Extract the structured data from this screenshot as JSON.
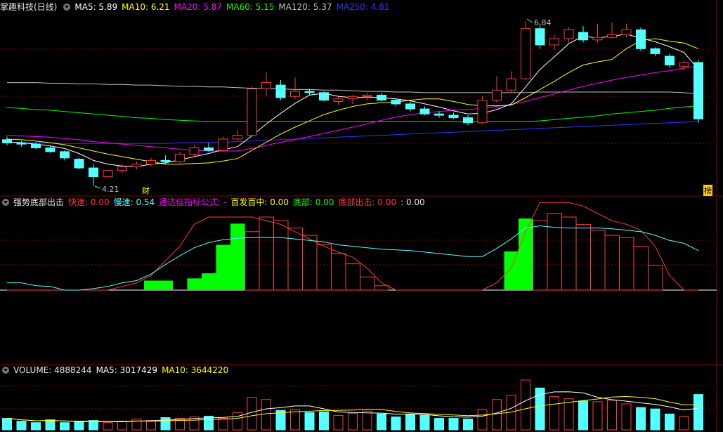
{
  "colors": {
    "up": "#ff3b3b",
    "down": "#54ffff",
    "ma5": "#ffffff",
    "ma10": "#ffff00",
    "ma20": "#ff00ff",
    "ma60": "#00ff00",
    "ma120": "#c0c0c0",
    "ma250": "#3333ff",
    "grid": "#800000",
    "green_bar": "#00ff00"
  },
  "price_panel": {
    "stock": "掌趣科技(日线)",
    "ma5": "MA5: 5.89",
    "ma10": "MA10: 6.21",
    "ma20": "MA20: 5.87",
    "ma60": "MA60: 5.15",
    "ma120": "MA120: 5.37",
    "ma250": "MA250: 4.81",
    "high_label": "6.84",
    "low_label": "4.21",
    "badge_cai": "财",
    "badge_bang": "榜"
  },
  "indicator_panel": {
    "title": "强势底部出击",
    "fast": "快速: 0.00",
    "slow": "慢速: 0.54",
    "formula": "通达信指标公式: -",
    "hit": "百发百中: 0.00",
    "bottom": "底部: 0.00",
    "bottom_out": "底部出击: 0.00",
    "extra": ": 0.00"
  },
  "volume_panel": {
    "volume": "VOLUME: 4888244",
    "ma5": "MA5: 3017429",
    "ma10": "MA10: 3644220"
  },
  "chart_data": {
    "type": "candlestick",
    "ohlc": [
      [
        4.95,
        5.0,
        4.86,
        4.9
      ],
      [
        4.9,
        4.93,
        4.84,
        4.88
      ],
      [
        4.88,
        4.91,
        4.8,
        4.82
      ],
      [
        4.82,
        4.86,
        4.74,
        4.76
      ],
      [
        4.76,
        4.78,
        4.62,
        4.66
      ],
      [
        4.64,
        4.66,
        4.48,
        4.5
      ],
      [
        4.5,
        4.56,
        4.21,
        4.36
      ],
      [
        4.36,
        4.48,
        4.34,
        4.46
      ],
      [
        4.46,
        4.56,
        4.42,
        4.52
      ],
      [
        4.52,
        4.6,
        4.48,
        4.56
      ],
      [
        4.56,
        4.66,
        4.52,
        4.62
      ],
      [
        4.62,
        4.7,
        4.56,
        4.6
      ],
      [
        4.6,
        4.76,
        4.58,
        4.72
      ],
      [
        4.72,
        4.86,
        4.68,
        4.82
      ],
      [
        4.82,
        4.9,
        4.76,
        4.78
      ],
      [
        4.78,
        5.0,
        4.76,
        4.96
      ],
      [
        4.96,
        5.1,
        4.94,
        5.02
      ],
      [
        5.02,
        5.8,
        5.0,
        5.76
      ],
      [
        5.76,
        6.02,
        5.64,
        5.86
      ],
      [
        5.82,
        5.9,
        5.58,
        5.62
      ],
      [
        5.64,
        5.94,
        5.6,
        5.72
      ],
      [
        5.72,
        5.76,
        5.66,
        5.7
      ],
      [
        5.7,
        5.72,
        5.56,
        5.58
      ],
      [
        5.56,
        5.64,
        5.5,
        5.6
      ],
      [
        5.6,
        5.66,
        5.52,
        5.64
      ],
      [
        5.64,
        5.7,
        5.58,
        5.66
      ],
      [
        5.66,
        5.7,
        5.56,
        5.58
      ],
      [
        5.58,
        5.62,
        5.48,
        5.52
      ],
      [
        5.52,
        5.56,
        5.4,
        5.44
      ],
      [
        5.44,
        5.48,
        5.34,
        5.36
      ],
      [
        5.36,
        5.4,
        5.3,
        5.34
      ],
      [
        5.34,
        5.38,
        5.28,
        5.3
      ],
      [
        5.3,
        5.34,
        5.18,
        5.22
      ],
      [
        5.22,
        5.64,
        5.2,
        5.58
      ],
      [
        5.58,
        5.96,
        5.54,
        5.74
      ],
      [
        5.74,
        6.04,
        5.7,
        5.92
      ],
      [
        5.92,
        6.84,
        5.9,
        6.72
      ],
      [
        6.72,
        6.8,
        6.4,
        6.46
      ],
      [
        6.46,
        6.62,
        6.38,
        6.56
      ],
      [
        6.56,
        6.74,
        6.48,
        6.7
      ],
      [
        6.66,
        6.76,
        6.5,
        6.54
      ],
      [
        6.54,
        6.8,
        6.5,
        6.58
      ],
      [
        6.58,
        6.82,
        6.56,
        6.62
      ],
      [
        6.62,
        6.8,
        6.58,
        6.7
      ],
      [
        6.7,
        6.74,
        6.36,
        6.4
      ],
      [
        6.4,
        6.42,
        6.28,
        6.32
      ],
      [
        6.28,
        6.32,
        6.1,
        6.14
      ],
      [
        6.12,
        6.2,
        6.06,
        6.18
      ],
      [
        6.18,
        6.22,
        5.22,
        5.28
      ]
    ],
    "ma5": [
      4.92,
      4.9,
      4.88,
      4.85,
      4.81,
      4.73,
      4.62,
      4.56,
      4.53,
      4.52,
      4.56,
      4.58,
      4.63,
      4.68,
      4.73,
      4.79,
      4.84,
      5.01,
      5.2,
      5.37,
      5.53,
      5.66,
      5.69,
      5.64,
      5.62,
      5.63,
      5.62,
      5.6,
      5.57,
      5.52,
      5.47,
      5.41,
      5.36,
      5.37,
      5.43,
      5.52,
      5.79,
      6.07,
      6.27,
      6.48,
      6.6,
      6.57,
      6.6,
      6.63,
      6.57,
      6.51,
      6.43,
      6.34,
      6.07
    ],
    "ma10": [
      4.96,
      4.95,
      4.93,
      4.9,
      4.87,
      4.82,
      4.77,
      4.72,
      4.68,
      4.64,
      4.6,
      4.56,
      4.56,
      4.57,
      4.58,
      4.61,
      4.65,
      4.78,
      4.91,
      5.04,
      5.15,
      5.25,
      5.35,
      5.42,
      5.48,
      5.52,
      5.54,
      5.55,
      5.58,
      5.6,
      5.6,
      5.56,
      5.51,
      5.49,
      5.49,
      5.5,
      5.62,
      5.75,
      5.88,
      6.02,
      6.14,
      6.19,
      6.23,
      6.4,
      6.53,
      6.56,
      6.52,
      6.49,
      6.4
    ],
    "ma20": [
      5.02,
      5.01,
      5.0,
      4.99,
      4.97,
      4.95,
      4.92,
      4.9,
      4.88,
      4.86,
      4.84,
      4.82,
      4.8,
      4.78,
      4.77,
      4.77,
      4.77,
      4.81,
      4.86,
      4.91,
      4.95,
      5.0,
      5.05,
      5.1,
      5.15,
      5.2,
      5.26,
      5.31,
      5.35,
      5.38,
      5.4,
      5.42,
      5.43,
      5.45,
      5.48,
      5.51,
      5.56,
      5.62,
      5.68,
      5.74,
      5.8,
      5.85,
      5.9,
      5.94,
      5.98,
      6.02,
      6.05,
      6.09,
      6.12
    ],
    "ma60": [
      5.46,
      5.45,
      5.43,
      5.42,
      5.4,
      5.38,
      5.36,
      5.34,
      5.32,
      5.3,
      5.29,
      5.27,
      5.26,
      5.25,
      5.24,
      5.24,
      5.24,
      5.24,
      5.24,
      5.24,
      5.24,
      5.24,
      5.24,
      5.24,
      5.24,
      5.24,
      5.24,
      5.24,
      5.24,
      5.24,
      5.24,
      5.24,
      5.24,
      5.24,
      5.24,
      5.24,
      5.24,
      5.25,
      5.27,
      5.29,
      5.31,
      5.33,
      5.36,
      5.38,
      5.4,
      5.42,
      5.45,
      5.47,
      5.49
    ],
    "ma120": [
      5.86,
      5.86,
      5.86,
      5.85,
      5.85,
      5.84,
      5.84,
      5.83,
      5.83,
      5.82,
      5.82,
      5.81,
      5.8,
      5.8,
      5.79,
      5.79,
      5.78,
      5.77,
      5.77,
      5.76,
      5.75,
      5.75,
      5.74,
      5.74,
      5.73,
      5.72,
      5.72,
      5.71,
      5.71,
      5.7,
      5.7,
      5.7,
      5.7,
      5.7,
      5.7,
      5.7,
      5.7,
      5.71,
      5.71,
      5.71,
      5.71,
      5.71,
      5.71,
      5.71,
      5.71,
      5.71,
      5.71,
      5.7,
      5.68
    ],
    "ma250": [
      4.9,
      4.9,
      4.9,
      4.9,
      4.89,
      4.89,
      4.89,
      4.89,
      4.89,
      4.89,
      4.89,
      4.89,
      4.9,
      4.9,
      4.91,
      4.91,
      4.92,
      4.93,
      4.94,
      4.95,
      4.96,
      4.97,
      4.98,
      4.99,
      5.0,
      5.01,
      5.02,
      5.03,
      5.04,
      5.05,
      5.06,
      5.07,
      5.08,
      5.09,
      5.1,
      5.11,
      5.12,
      5.13,
      5.14,
      5.15,
      5.16,
      5.17,
      5.18,
      5.19,
      5.2,
      5.21,
      5.22,
      5.23,
      5.24
    ],
    "indicator": {
      "red_bars": [
        0,
        0,
        0,
        0,
        0,
        0,
        0,
        0,
        0,
        0,
        0,
        0,
        0,
        0,
        0,
        0,
        0,
        0.8,
        1.0,
        0.95,
        0.85,
        0.75,
        0.62,
        0.5,
        0.36,
        0.18,
        0.06,
        0,
        0,
        0,
        0,
        0,
        0,
        0,
        0,
        0,
        0,
        0.95,
        1.05,
        1.0,
        0.9,
        0.82,
        0.75,
        0.72,
        0.6,
        0.34,
        0,
        0,
        0
      ],
      "green_bars": [
        0,
        0,
        0,
        0,
        0,
        0,
        0,
        0,
        0,
        0,
        0.13,
        0.13,
        0,
        0.16,
        0.23,
        0.62,
        0.91,
        0,
        0,
        0,
        0,
        0,
        0,
        0,
        0,
        0,
        0,
        0,
        0,
        0,
        0,
        0,
        0,
        0,
        0,
        0.53,
        0.98,
        0,
        0,
        0,
        0,
        0,
        0,
        0,
        0,
        0,
        0,
        0,
        0
      ],
      "slow": [
        0.1,
        0.1,
        0.06,
        0.05,
        0.0,
        0.0,
        0.02,
        0.05,
        0.1,
        0.13,
        0.22,
        0.35,
        0.47,
        0.58,
        0.65,
        0.69,
        0.71,
        0.72,
        0.72,
        0.72,
        0.7,
        0.68,
        0.66,
        0.62,
        0.6,
        0.58,
        0.56,
        0.55,
        0.54,
        0.52,
        0.5,
        0.48,
        0.46,
        0.46,
        0.57,
        0.7,
        0.85,
        0.88,
        0.86,
        0.85,
        0.85,
        0.85,
        0.84,
        0.82,
        0.8,
        0.75,
        0.68,
        0.64,
        0.54
      ],
      "red_line": [
        0,
        0,
        0,
        0,
        0,
        0,
        0,
        0,
        0.05,
        0.1,
        0.2,
        0.4,
        0.6,
        0.9,
        1.0,
        1.0,
        1.0,
        1.0,
        0.95,
        0.9,
        0.8,
        0.7,
        0.6,
        0.52,
        0.45,
        0.3,
        0.1,
        0,
        0,
        0,
        0,
        0,
        0,
        0,
        0.1,
        0.3,
        0.8,
        1.2,
        1.2,
        1.2,
        1.15,
        1.05,
        0.95,
        0.9,
        0.82,
        0.6,
        0.2,
        0,
        0
      ]
    },
    "volume": [
      1.6,
      1.2,
      1.0,
      1.4,
      1.0,
      1.1,
      1.3,
      1.0,
      1.2,
      1.5,
      1.3,
      1.7,
      1.6,
      1.8,
      1.9,
      1.6,
      2.4,
      4.5,
      4.2,
      2.7,
      2.8,
      2.4,
      2.5,
      2.0,
      2.3,
      2.6,
      2.2,
      1.8,
      2.1,
      2.0,
      1.6,
      1.6,
      1.5,
      2.8,
      4.2,
      4.8,
      6.9,
      5.8,
      4.6,
      4.3,
      4.0,
      3.9,
      4.1,
      3.6,
      3.1,
      2.9,
      2.2,
      1.9,
      4.9
    ]
  }
}
